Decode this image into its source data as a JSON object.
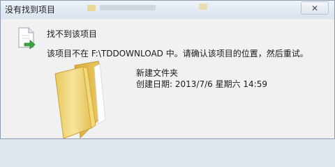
{
  "window": {
    "title": "没有找到项目",
    "close_glyph": "✕"
  },
  "dialog": {
    "heading": "找不到该项目",
    "message": "该项目不在 F:\\TDDOWNLOAD 中。请确认该项目的位置，然后重试。",
    "item": {
      "name": "新建文件夹",
      "date_label": "创建日期",
      "date_separator": ": ",
      "date_value": "2013/7/6 星期六 14:59"
    }
  },
  "icons": {
    "document": "document-arrow-icon",
    "folder": "folder-icon",
    "close": "close-icon"
  },
  "colors": {
    "folder_fill": "#f2d77a",
    "arrow_green": "#3aa83a",
    "titlebar": "#dde5ee"
  }
}
